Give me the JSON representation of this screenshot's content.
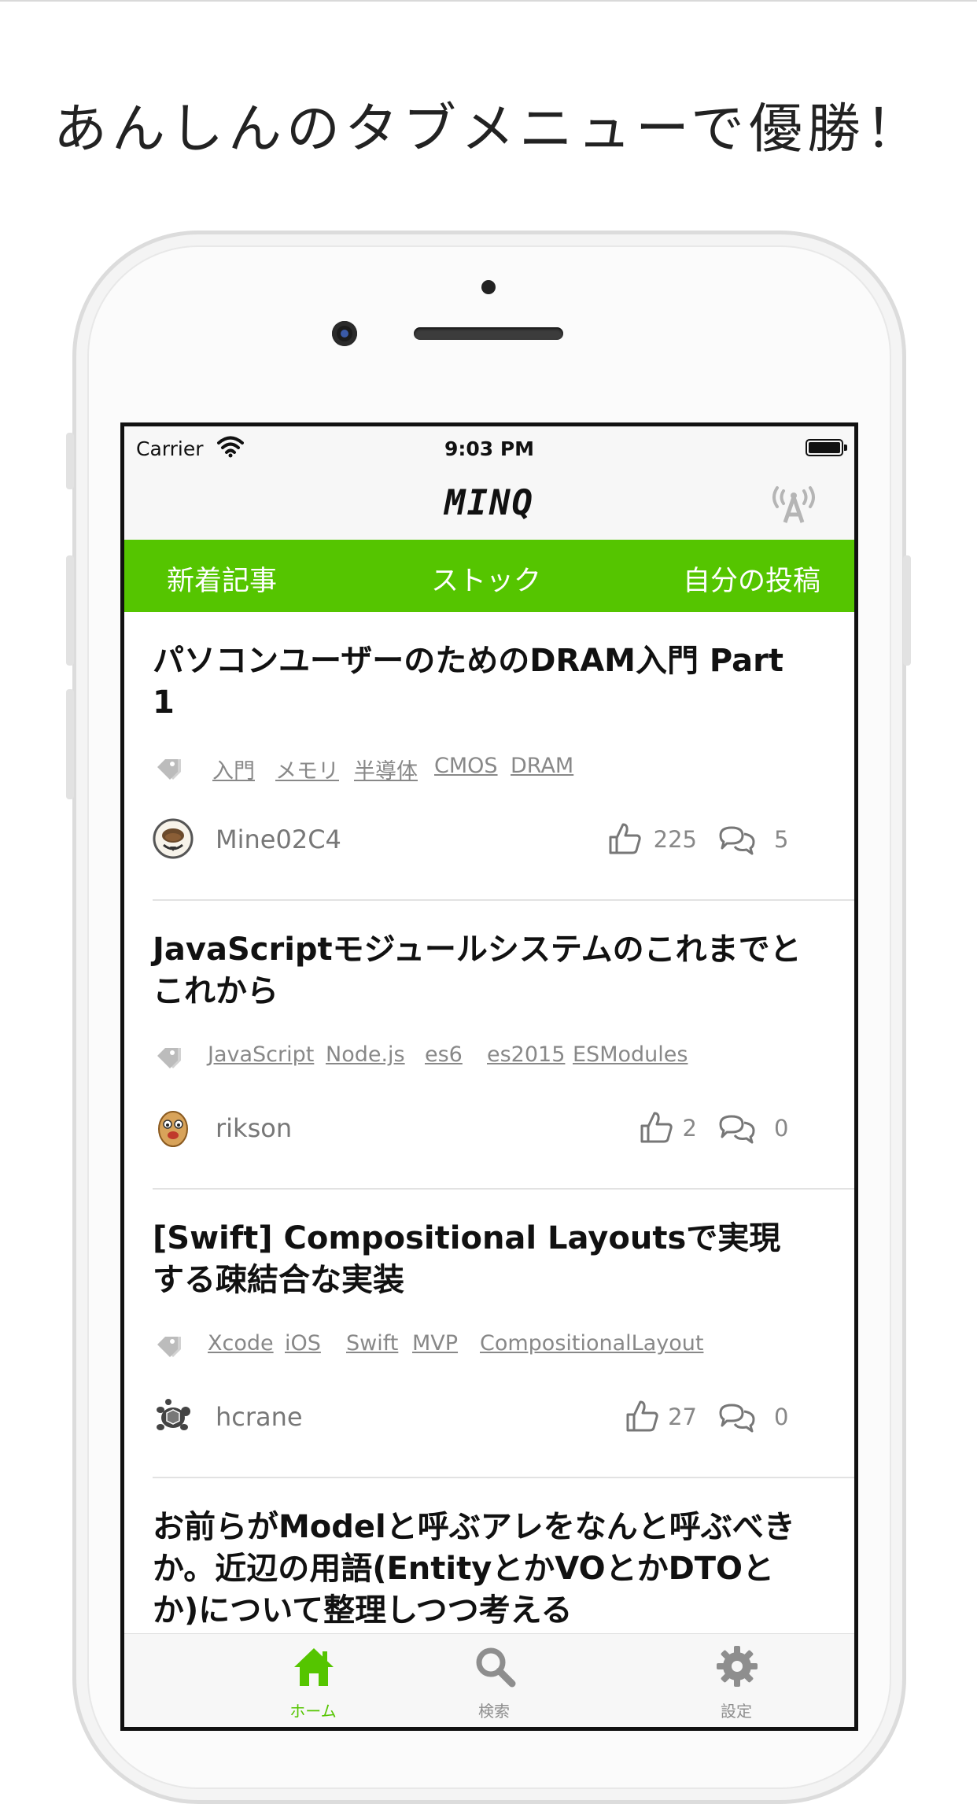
{
  "headline": "あんしんのタブメニューで優勝！",
  "status_bar": {
    "carrier": "Carrier",
    "time": "9:03 PM"
  },
  "nav_bar": {
    "logo": "MINQ"
  },
  "category_tabs": [
    {
      "label": "新着記事"
    },
    {
      "label": "ストック"
    },
    {
      "label": "自分の投稿"
    }
  ],
  "articles": [
    {
      "title": "パソコンユーザーのためのDRAM入門 Part 1",
      "tags": [
        "入門",
        "メモリ",
        "半導体",
        "CMOS",
        "DRAM"
      ],
      "author": "Mine02C4",
      "likes": "225",
      "comments": "5"
    },
    {
      "title": "JavaScriptモジュールシステムのこれまでとこれから",
      "tags": [
        "JavaScript",
        "Node.js",
        "es6",
        "es2015",
        "ESModules"
      ],
      "author": "rikson",
      "likes": "2",
      "comments": "0"
    },
    {
      "title": "[Swift] Compositional Layoutsで実現する疎結合な実装",
      "tags": [
        "Xcode",
        "iOS",
        "Swift",
        "MVP",
        "CompositionalLayout"
      ],
      "author": "hcrane",
      "likes": "27",
      "comments": "0"
    },
    {
      "title": "お前らがModelと呼ぶアレをなんと呼ぶべきか。近辺の用語(EntityとかVOとかDTOとか)について整理しつつ考える",
      "tags": [],
      "author": "",
      "likes": "",
      "comments": ""
    }
  ],
  "tab_bar": {
    "items": [
      {
        "label": "ホーム",
        "icon": "home-icon",
        "active": true
      },
      {
        "label": "検索",
        "icon": "search-icon",
        "active": false
      },
      {
        "label": "設定",
        "icon": "gear-icon",
        "active": false
      }
    ]
  },
  "colors": {
    "accent": "#55c500",
    "muted": "#888888",
    "tab_inactive": "#8e8e8e"
  }
}
